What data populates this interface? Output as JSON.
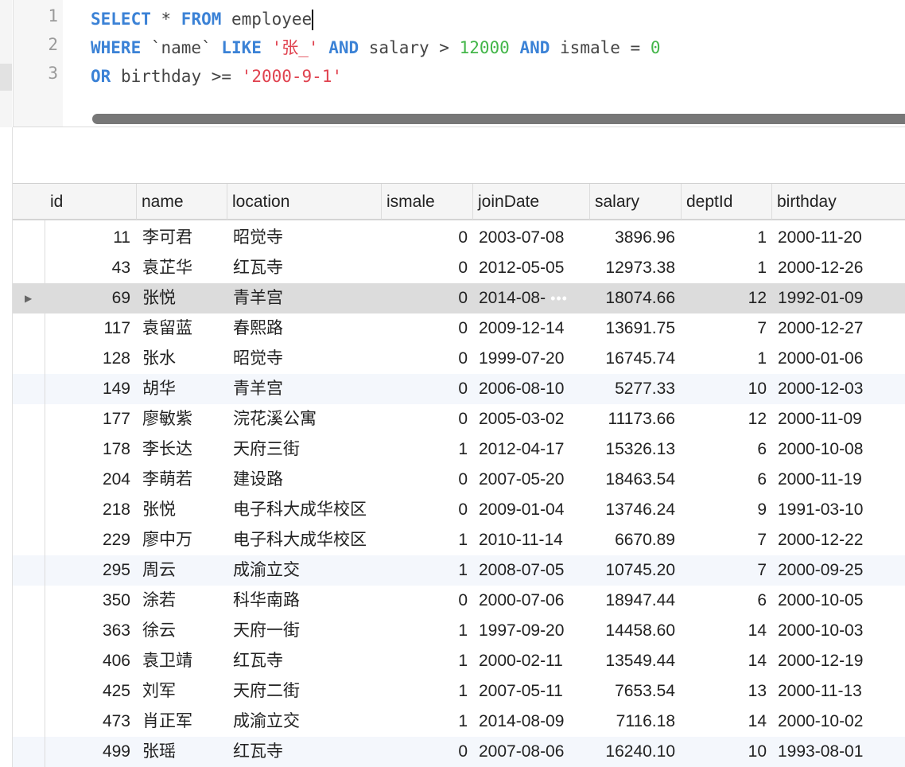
{
  "editor": {
    "line_numbers": [
      "1",
      "2",
      "3"
    ],
    "lines": [
      [
        {
          "t": "SELECT",
          "c": "kw"
        },
        {
          "t": " * ",
          "c": ""
        },
        {
          "t": "FROM",
          "c": "kw"
        },
        {
          "t": " employee",
          "c": ""
        }
      ],
      [
        {
          "t": "WHERE",
          "c": "kw"
        },
        {
          "t": " `name` ",
          "c": ""
        },
        {
          "t": "LIKE",
          "c": "kw"
        },
        {
          "t": " ",
          "c": ""
        },
        {
          "t": "'张_'",
          "c": "str"
        },
        {
          "t": " ",
          "c": ""
        },
        {
          "t": "AND",
          "c": "kw"
        },
        {
          "t": " salary > ",
          "c": ""
        },
        {
          "t": "12000",
          "c": "num"
        },
        {
          "t": " ",
          "c": ""
        },
        {
          "t": "AND",
          "c": "kw"
        },
        {
          "t": " ismale = ",
          "c": ""
        },
        {
          "t": "0",
          "c": "num"
        }
      ],
      [
        {
          "t": "OR",
          "c": "kw"
        },
        {
          "t": " birthday >= ",
          "c": ""
        },
        {
          "t": "'2000-9-1'",
          "c": "str"
        }
      ]
    ]
  },
  "grid": {
    "columns": [
      "id",
      "name",
      "location",
      "ismale",
      "joinDate",
      "salary",
      "deptId",
      "birthday"
    ],
    "selected_marker": "▶",
    "truncation_marker": "•••",
    "rows": [
      [
        "11",
        "李可君",
        "昭觉寺",
        "0",
        "2003-07-08",
        "3896.96",
        "1",
        "2000-11-20"
      ],
      [
        "43",
        "袁芷华",
        "红瓦寺",
        "0",
        "2012-05-05",
        "12973.38",
        "1",
        "2000-12-26"
      ],
      [
        "69",
        "张悦",
        "青羊宫",
        "0",
        "2014-08-",
        "18074.66",
        "12",
        "1992-01-09"
      ],
      [
        "117",
        "袁留蓝",
        "春熙路",
        "0",
        "2009-12-14",
        "13691.75",
        "7",
        "2000-12-27"
      ],
      [
        "128",
        "张水",
        "昭觉寺",
        "0",
        "1999-07-20",
        "16745.74",
        "1",
        "2000-01-06"
      ],
      [
        "149",
        "胡华",
        "青羊宫",
        "0",
        "2006-08-10",
        "5277.33",
        "10",
        "2000-12-03"
      ],
      [
        "177",
        "廖敏紫",
        "浣花溪公寓",
        "0",
        "2005-03-02",
        "11173.66",
        "12",
        "2000-11-09"
      ],
      [
        "178",
        "李长达",
        "天府三街",
        "1",
        "2012-04-17",
        "15326.13",
        "6",
        "2000-10-08"
      ],
      [
        "204",
        "李萌若",
        "建设路",
        "0",
        "2007-05-20",
        "18463.54",
        "6",
        "2000-11-19"
      ],
      [
        "218",
        "张悦",
        "电子科大成华校区",
        "0",
        "2009-01-04",
        "13746.24",
        "9",
        "1991-03-10"
      ],
      [
        "229",
        "廖中万",
        "电子科大成华校区",
        "1",
        "2010-11-14",
        "6670.89",
        "7",
        "2000-12-22"
      ],
      [
        "295",
        "周云",
        "成渝立交",
        "1",
        "2008-07-05",
        "10745.20",
        "7",
        "2000-09-25"
      ],
      [
        "350",
        "涂若",
        "科华南路",
        "0",
        "2000-07-06",
        "18947.44",
        "6",
        "2000-10-05"
      ],
      [
        "363",
        "徐云",
        "天府一街",
        "1",
        "1997-09-20",
        "14458.60",
        "14",
        "2000-10-03"
      ],
      [
        "406",
        "袁卫靖",
        "红瓦寺",
        "1",
        "2000-02-11",
        "13549.44",
        "14",
        "2000-12-19"
      ],
      [
        "425",
        "刘军",
        "天府二街",
        "1",
        "2007-05-11",
        "7653.54",
        "13",
        "2000-11-13"
      ],
      [
        "473",
        "肖正军",
        "成渝立交",
        "1",
        "2014-08-09",
        "7116.18",
        "14",
        "2000-10-02"
      ],
      [
        "499",
        "张瑶",
        "红瓦寺",
        "0",
        "2007-08-06",
        "16240.10",
        "10",
        "1993-08-01"
      ]
    ]
  }
}
